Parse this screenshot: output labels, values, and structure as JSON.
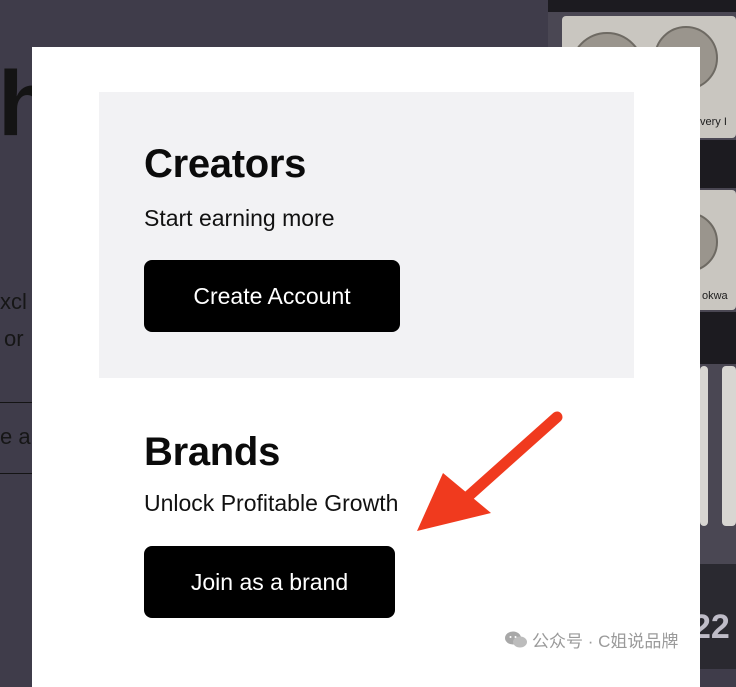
{
  "background": {
    "hero_letter": "h",
    "line1": "xcl",
    "line2": "or",
    "input_text": "e a",
    "product_labels": [
      "very I",
      "okwa"
    ],
    "corner_digits": "22"
  },
  "modal": {
    "creators": {
      "title": "Creators",
      "subtitle": "Start earning more",
      "button": "Create Account"
    },
    "brands": {
      "title": "Brands",
      "subtitle": "Unlock Profitable Growth",
      "button": "Join as a brand"
    }
  },
  "annotation": {
    "arrow_color": "#f03a1e"
  },
  "watermark": {
    "icon": "wechat-icon",
    "text": "公众号 · C姐说品牌"
  }
}
